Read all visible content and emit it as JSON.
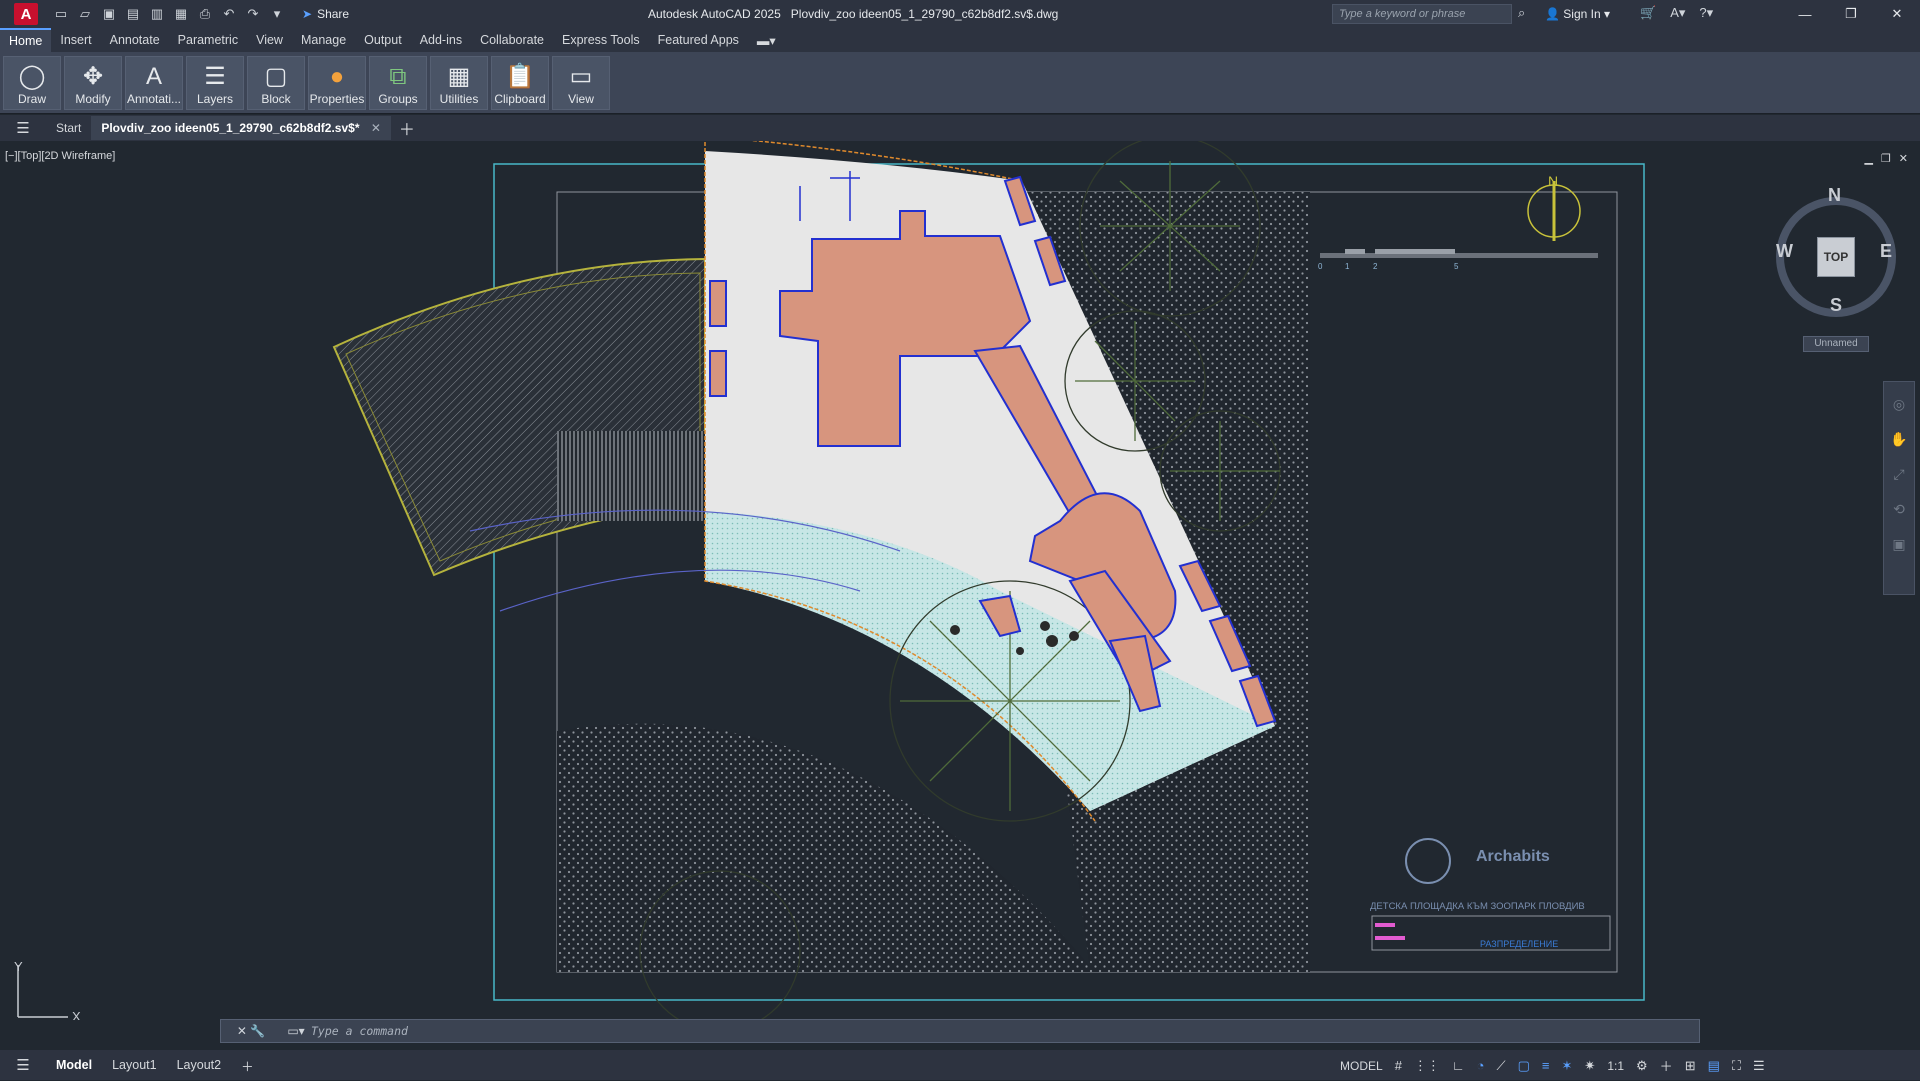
{
  "app": {
    "logo_letter": "A",
    "title": "Autodesk AutoCAD 2025",
    "filename": "Plovdiv_zoo ideen05_1_29790_c62b8df2.sv$.dwg",
    "share_label": "Share",
    "search_placeholder": "Type a keyword or phrase",
    "signin_label": "Sign In"
  },
  "ribbon": {
    "tabs": [
      {
        "label": "Home"
      },
      {
        "label": "Insert"
      },
      {
        "label": "Annotate"
      },
      {
        "label": "Parametric"
      },
      {
        "label": "View"
      },
      {
        "label": "Manage"
      },
      {
        "label": "Output"
      },
      {
        "label": "Add-ins"
      },
      {
        "label": "Collaborate"
      },
      {
        "label": "Express Tools"
      },
      {
        "label": "Featured Apps"
      }
    ],
    "buttons": [
      {
        "label": "Draw",
        "icon": "circle-icon"
      },
      {
        "label": "Modify",
        "icon": "move-icon"
      },
      {
        "label": "Annotati...",
        "icon": "text-icon"
      },
      {
        "label": "Layers",
        "icon": "layers-icon"
      },
      {
        "label": "Block",
        "icon": "block-icon"
      },
      {
        "label": "Properties",
        "icon": "color-wheel-icon"
      },
      {
        "label": "Groups",
        "icon": "groups-icon"
      },
      {
        "label": "Utilities",
        "icon": "calculator-icon"
      },
      {
        "label": "Clipboard",
        "icon": "clipboard-icon"
      },
      {
        "label": "View",
        "icon": "view-icon"
      }
    ]
  },
  "filetabs": {
    "start_label": "Start",
    "active_label": "Plovdiv_zoo ideen05_1_29790_c62b8df2.sv$*"
  },
  "viewport": {
    "label": "[−][Top][2D Wireframe]",
    "viewcube": {
      "top": "TOP",
      "n": "N",
      "s": "S",
      "e": "E",
      "w": "W",
      "unnamed": "Unnamed"
    },
    "ucs": {
      "y": "Y",
      "x": "X"
    },
    "drawing": {
      "title_block": {
        "brand": "Archabits",
        "caption": "ДЕТСКА    ПЛОЩАДКА    КЪМ    ЗООПАРК    ПЛОВДИВ",
        "sub": "РАЗПРЕДЕЛЕНИЕ"
      },
      "scale_bar": [
        "0",
        "1",
        "2",
        "5"
      ],
      "north": "N"
    }
  },
  "command": {
    "placeholder": "Type a command"
  },
  "status": {
    "layout_tabs": [
      {
        "label": "Model"
      },
      {
        "label": "Layout1"
      },
      {
        "label": "Layout2"
      }
    ],
    "model_label": "MODEL",
    "scale_label": "1:1"
  },
  "colors": {
    "background": "#212830",
    "accent": "#5aa0ff",
    "building_fill": "#d7957e",
    "outline_blue": "#2330d0",
    "paper_border": "#49b7c8"
  }
}
